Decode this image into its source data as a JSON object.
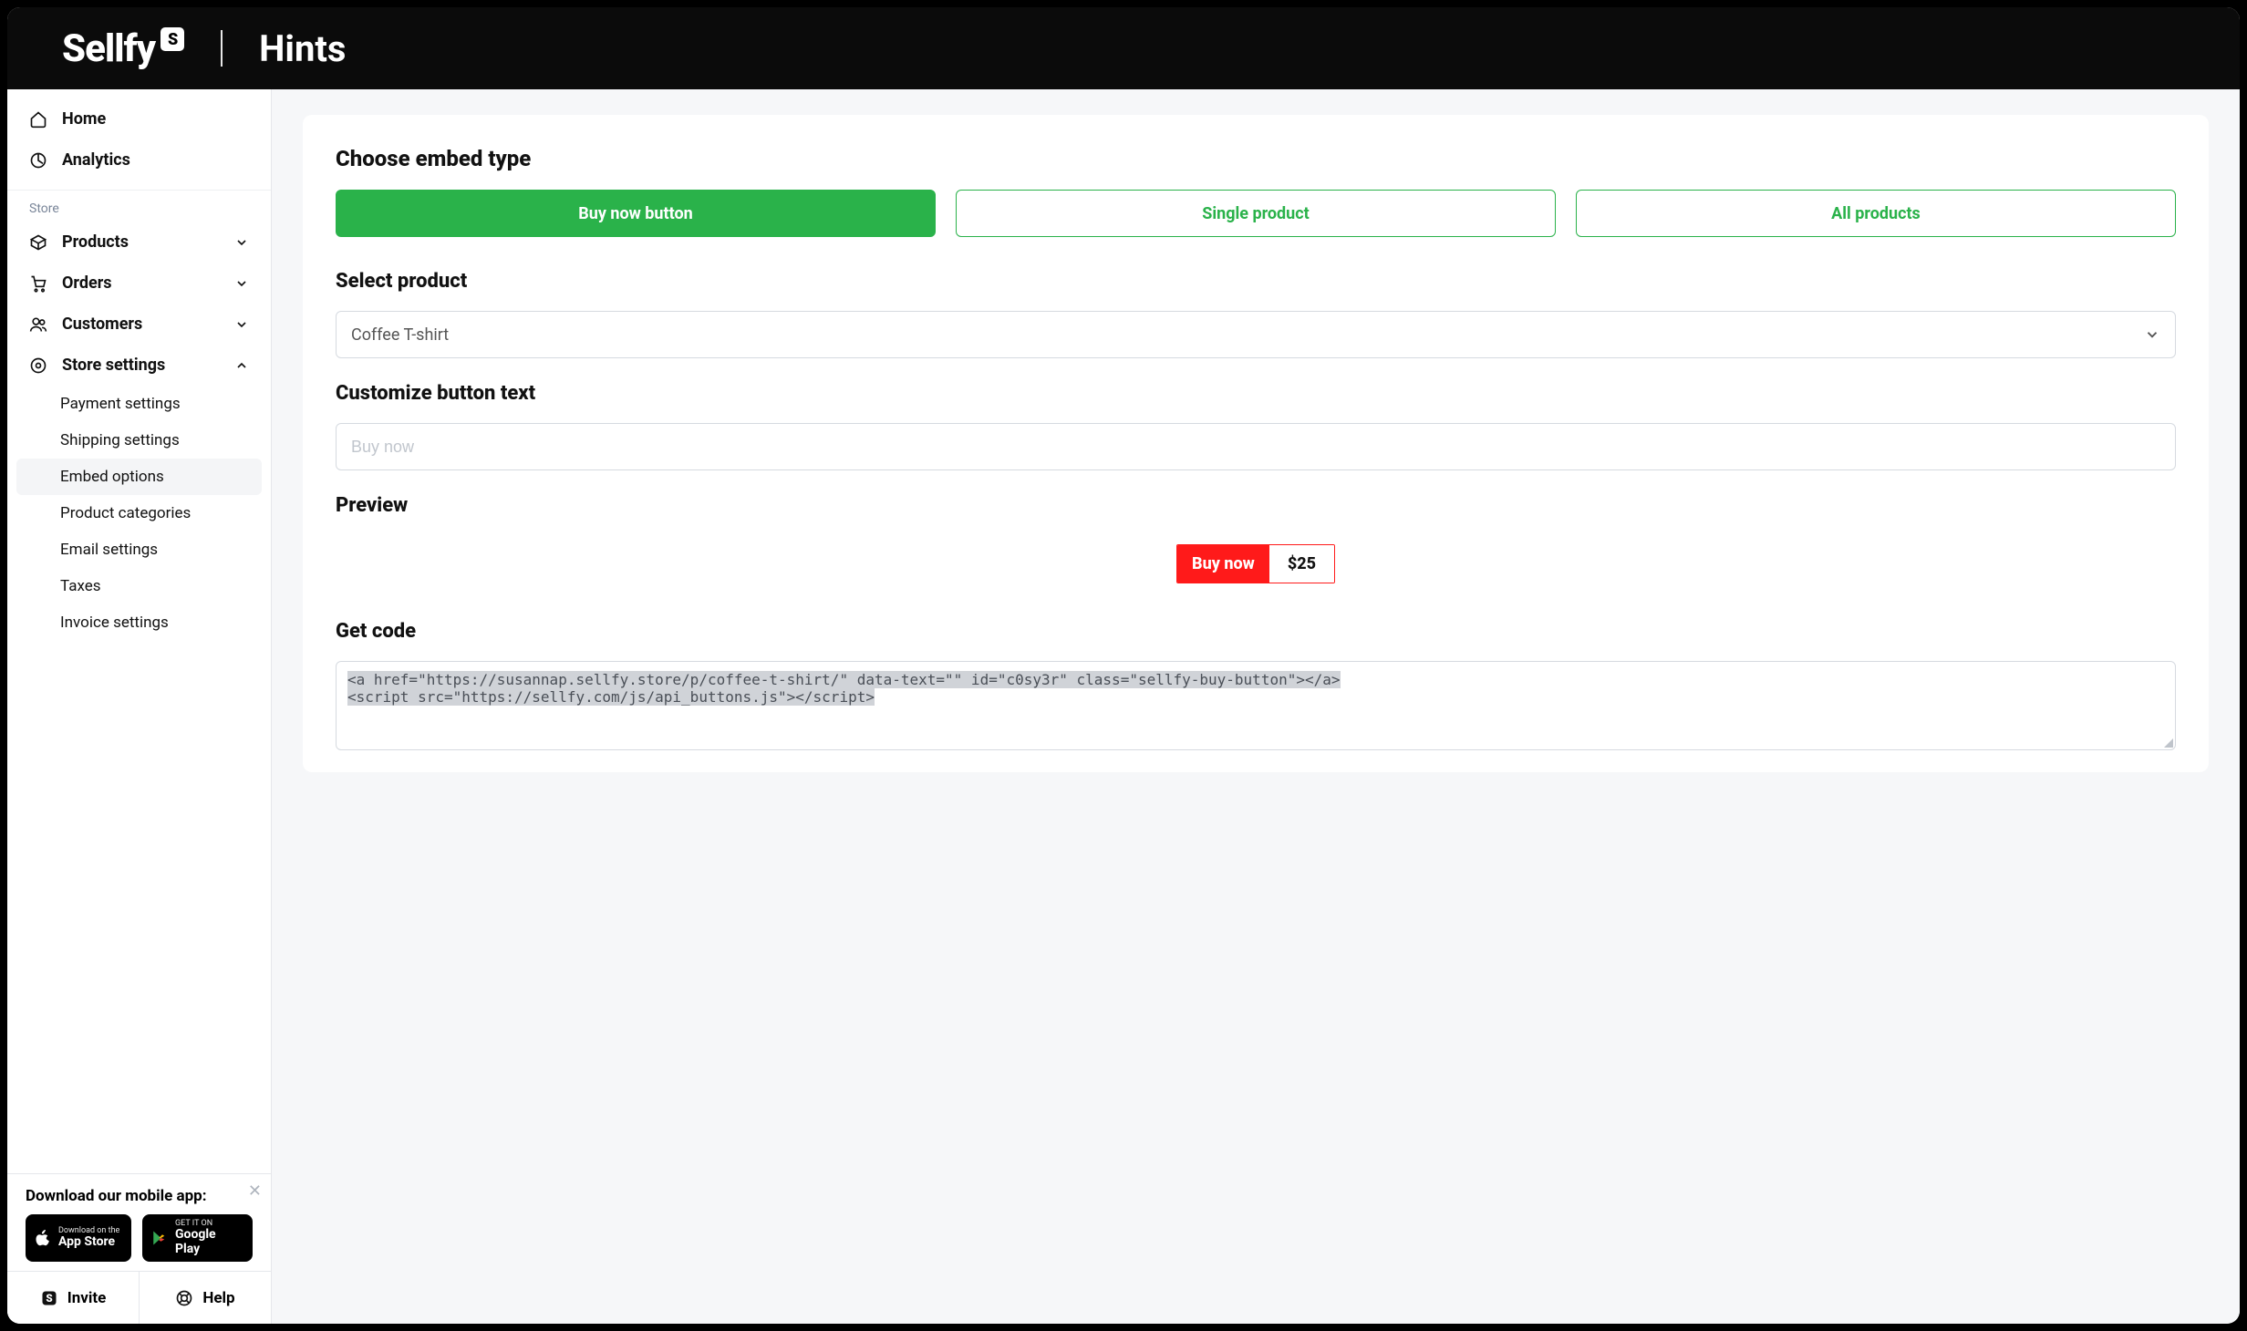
{
  "topbar": {
    "brand": "Sellfy",
    "page_title": "Hints"
  },
  "sidebar": {
    "primary": [
      {
        "label": "Home"
      },
      {
        "label": "Analytics"
      }
    ],
    "group_label": "Store",
    "store": [
      {
        "label": "Products"
      },
      {
        "label": "Orders"
      },
      {
        "label": "Customers"
      },
      {
        "label": "Store settings"
      }
    ],
    "settings_sub": [
      "Payment settings",
      "Shipping settings",
      "Embed options",
      "Product categories",
      "Email settings",
      "Taxes",
      "Invoice settings"
    ],
    "active_sub": "Embed options",
    "download_title": "Download our mobile app:",
    "appstore_top": "Download on the",
    "appstore_bottom": "App Store",
    "play_top": "GET IT ON",
    "play_bottom": "Google Play",
    "invite": "Invite",
    "help": "Help"
  },
  "main": {
    "choose_title": "Choose embed type",
    "tabs": [
      "Buy now button",
      "Single product",
      "All products"
    ],
    "select_title": "Select product",
    "selected_product": "Coffee T-shirt",
    "customize_title": "Customize button text",
    "customize_placeholder": "Buy now",
    "preview_title": "Preview",
    "preview_button_text": "Buy now",
    "preview_price": "$25",
    "code_title": "Get code",
    "code_line1": "<a href=\"https://susannap.sellfy.store/p/coffee-t-shirt/\" data-text=\"\" id=\"c0sy3r\" class=\"sellfy-buy-button\"></a>",
    "code_line2": "<script src=\"https://sellfy.com/js/api_buttons.js\"></scr"
  }
}
